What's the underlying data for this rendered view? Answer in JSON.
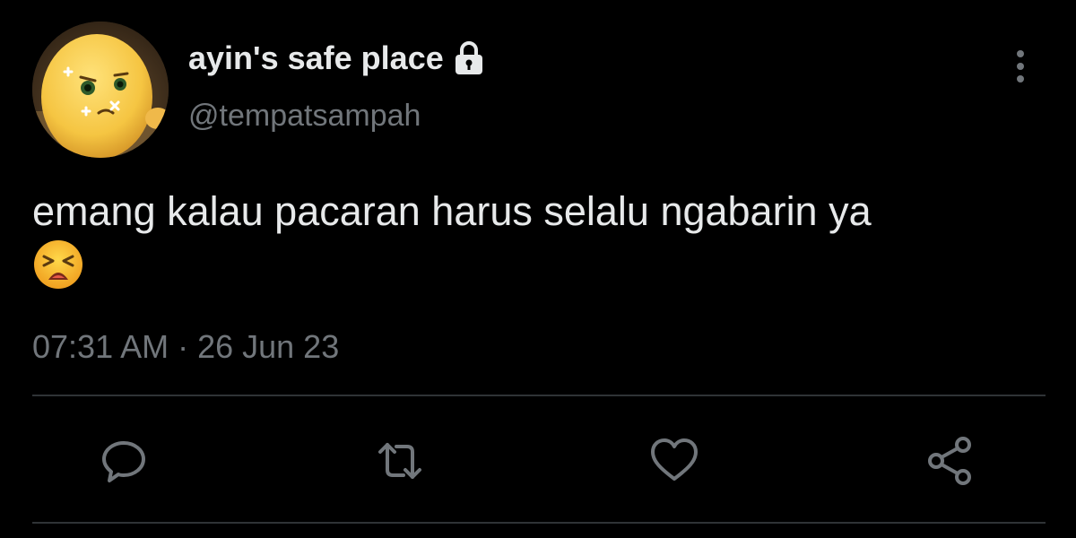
{
  "tweet": {
    "display_name": "ayin's safe place",
    "handle": "@tempatsampah",
    "text": "emang kalau pacaran harus selalu ngabarin ya",
    "emoji": "tired-face-icon",
    "timestamp": "07:31 AM · 26 Jun 23",
    "protected_icon": "lock-icon"
  },
  "actions": {
    "reply_icon": "reply-icon",
    "retweet_icon": "retweet-icon",
    "like_icon": "heart-icon",
    "share_icon": "share-icon"
  },
  "colors": {
    "background": "#000000",
    "primary_text": "#e7e9ea",
    "secondary_text": "#71767b",
    "divider": "#2f3336"
  }
}
